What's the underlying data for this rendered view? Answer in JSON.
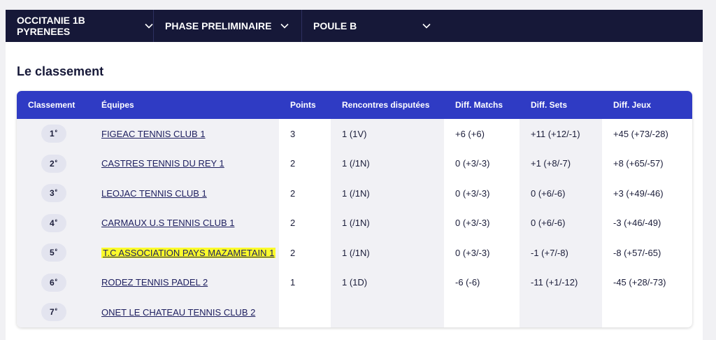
{
  "filters": [
    {
      "label": "OCCITANIE 1B PYRENEES"
    },
    {
      "label": "PHASE PRELIMINAIRE"
    },
    {
      "label": "POULE B"
    }
  ],
  "section_title": "Le classement",
  "table": {
    "headers": {
      "rank": "Classement",
      "team": "Équipes",
      "points": "Points",
      "played": "Rencontres disputées",
      "matches": "Diff. Matchs",
      "sets": "Diff. Sets",
      "games": "Diff. Jeux"
    },
    "rows": [
      {
        "rank": "1",
        "suffix": "e",
        "team": "FIGEAC TENNIS CLUB 1",
        "points": "3",
        "played": "1 (1V)",
        "matches": "+6 (+6)",
        "sets": "+11 (+12/-1)",
        "games": "+45 (+73/-28)",
        "highlight": false
      },
      {
        "rank": "2",
        "suffix": "e",
        "team": "CASTRES TENNIS DU REY 1",
        "points": "2",
        "played": "1 (/1N)",
        "matches": "0 (+3/-3)",
        "sets": "+1 (+8/-7)",
        "games": "+8 (+65/-57)",
        "highlight": false
      },
      {
        "rank": "3",
        "suffix": "e",
        "team": "LEOJAC TENNIS CLUB 1",
        "points": "2",
        "played": "1 (/1N)",
        "matches": "0 (+3/-3)",
        "sets": "0 (+6/-6)",
        "games": "+3 (+49/-46)",
        "highlight": false
      },
      {
        "rank": "4",
        "suffix": "e",
        "team": "CARMAUX U.S TENNIS CLUB 1",
        "points": "2",
        "played": "1 (/1N)",
        "matches": "0 (+3/-3)",
        "sets": "0 (+6/-6)",
        "games": "-3 (+46/-49)",
        "highlight": false
      },
      {
        "rank": "5",
        "suffix": "e",
        "team": "T.C ASSOCIATION PAYS MAZAMETAIN 1",
        "points": "2",
        "played": "1 (/1N)",
        "matches": "0 (+3/-3)",
        "sets": "-1 (+7/-8)",
        "games": "-8 (+57/-65)",
        "highlight": true
      },
      {
        "rank": "6",
        "suffix": "e",
        "team": "RODEZ TENNIS PADEL 2",
        "points": "1",
        "played": "1 (1D)",
        "matches": "-6 (-6)",
        "sets": "-11 (+1/-12)",
        "games": "-45 (+28/-73)",
        "highlight": false
      },
      {
        "rank": "7",
        "suffix": "e",
        "team": "ONET LE CHATEAU TENNIS CLUB 2",
        "points": "",
        "played": "",
        "matches": "",
        "sets": "",
        "games": "",
        "highlight": false
      }
    ]
  },
  "colors": {
    "topbar": "#161838",
    "table_header": "#2f3bc4",
    "highlight": "#fbfb2a"
  }
}
